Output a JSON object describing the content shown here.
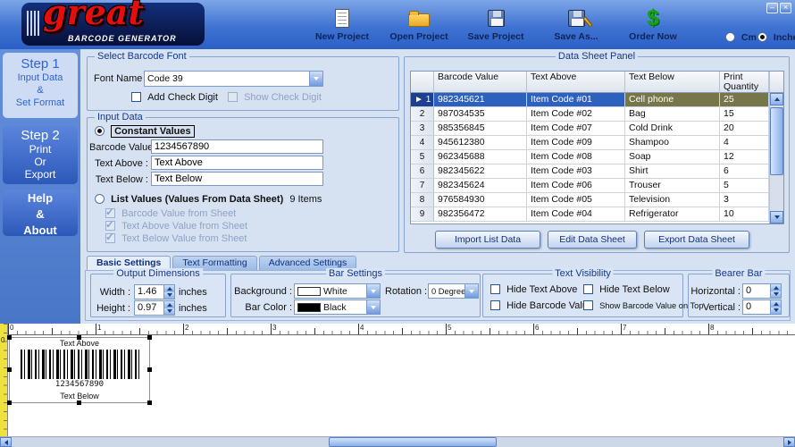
{
  "colors": {
    "logo_red": "#e60d0d",
    "selection_blue": "#2e61be",
    "selection_olive": "#76764a",
    "ruler_yellow": "#f0e23c",
    "order_green": "#12a312"
  },
  "window": {
    "minimize_glyph": "–",
    "close_glyph": "×"
  },
  "logo": {
    "name": "great",
    "subtitle": "BARCODE GENERATOR"
  },
  "toolbar": {
    "items": [
      {
        "label": "New  Project"
      },
      {
        "label": "Open  Project"
      },
      {
        "label": "Save Project"
      },
      {
        "label": "Save As..."
      },
      {
        "label": "Order Now"
      }
    ],
    "dollar_glyph": "$",
    "units": {
      "cm": "Cm",
      "inches": "Inches",
      "selected_unit": "Inches"
    }
  },
  "sidebar": {
    "step1": {
      "title": "Step 1",
      "line1": "Input Data",
      "line2": "&",
      "line3": "Set Format"
    },
    "step2": {
      "title": "Step 2",
      "line1": "Print",
      "line2": "Or",
      "line3": "Export"
    },
    "help": {
      "line1": "Help",
      "line2": "&",
      "line3": "About"
    }
  },
  "font_panel": {
    "title": "Select Barcode Font",
    "font_name_label": "Font Name :",
    "font_value": "Code 39",
    "add_check_digit": "Add Check Digit",
    "show_check_digit": "Show Check Digit"
  },
  "input_panel": {
    "title": "Input Data",
    "constant_label": "Constant Values",
    "barcode_label": "Barcode Value :",
    "barcode_value": "1234567890",
    "above_label": "Text Above :",
    "above_value": "Text Above",
    "below_label": "Text Below :",
    "below_value": "Text Below",
    "list_label": "List Values (Values From Data Sheet)",
    "items_count": "9 Items",
    "sheet_checks": [
      "Barcode Value from Sheet",
      "Text Above Value from Sheet",
      "Text Below Value from Sheet"
    ]
  },
  "data_sheet": {
    "title": "Data Sheet Panel",
    "pointer_glyph": "►",
    "columns": [
      "Barcode Value",
      "Text Above",
      "Text Below",
      "Print Quantity"
    ],
    "rows": [
      {
        "num": "1",
        "barcode": "982345621",
        "text_above": "Item Code #01",
        "text_below": "Cell phone",
        "qty": "25",
        "selected": true
      },
      {
        "num": "2",
        "barcode": "987034535",
        "text_above": "Item Code #02",
        "text_below": "Bag",
        "qty": "15"
      },
      {
        "num": "3",
        "barcode": "985356845",
        "text_above": "Item Code #07",
        "text_below": "Cold Drink",
        "qty": "20"
      },
      {
        "num": "4",
        "barcode": "945612380",
        "text_above": "Item Code #09",
        "text_below": "Shampoo",
        "qty": "4"
      },
      {
        "num": "5",
        "barcode": "962345688",
        "text_above": "Item Code #08",
        "text_below": "Soap",
        "qty": "12"
      },
      {
        "num": "6",
        "barcode": "982345622",
        "text_above": "Item Code #03",
        "text_below": "Shirt",
        "qty": "6"
      },
      {
        "num": "7",
        "barcode": "982345624",
        "text_above": "Item Code #06",
        "text_below": "Trouser",
        "qty": "5"
      },
      {
        "num": "8",
        "barcode": "976584930",
        "text_above": "Item Code #05",
        "text_below": "Television",
        "qty": "3"
      },
      {
        "num": "9",
        "barcode": "982356472",
        "text_above": "Item Code #04",
        "text_below": "Refrigerator",
        "qty": "10"
      }
    ],
    "buttons": [
      "Import List Data",
      "Edit Data Sheet",
      "Export Data Sheet"
    ]
  },
  "settings": {
    "tabs": [
      {
        "label": "Basic Settings",
        "active": true
      },
      {
        "label": "Text Formatting"
      },
      {
        "label": "Advanced Settings"
      }
    ],
    "output_dimensions": {
      "title": "Output Dimensions",
      "width_label": "Width :",
      "width_value": "1.46",
      "width_unit": "inches",
      "height_label": "Height :",
      "height_value": "0.97",
      "height_unit": "inches"
    },
    "bar_settings": {
      "title": "Bar Settings",
      "background_label": "Background :",
      "background_value": "White",
      "bar_color_label": "Bar Color :",
      "bar_color_value": "Black",
      "rotation_label": "Rotation :",
      "rotation_value": "0 Degree"
    },
    "text_visibility": {
      "title": "Text Visibility",
      "hide_text_above": "Hide Text Above",
      "hide_text_below": "Hide Text Below",
      "hide_barcode_value": "Hide Barcode Value",
      "show_barcode_value_on_top": "Show Barcode Value on Top"
    },
    "bearer_bar": {
      "title": "Bearer Bar",
      "horizontal_label": "Horizontal :",
      "horizontal_value": "0",
      "vertical_label": "Vertical :",
      "vertical_value": "0"
    }
  },
  "canvas": {
    "ruler_numbers": [
      "0",
      "1",
      "2",
      "3",
      "4",
      "5",
      "6",
      "7",
      "8"
    ],
    "vruler_label": "0",
    "preview": {
      "text_above": "Text Above",
      "value": "1234567890",
      "text_below": "Text Below"
    }
  }
}
